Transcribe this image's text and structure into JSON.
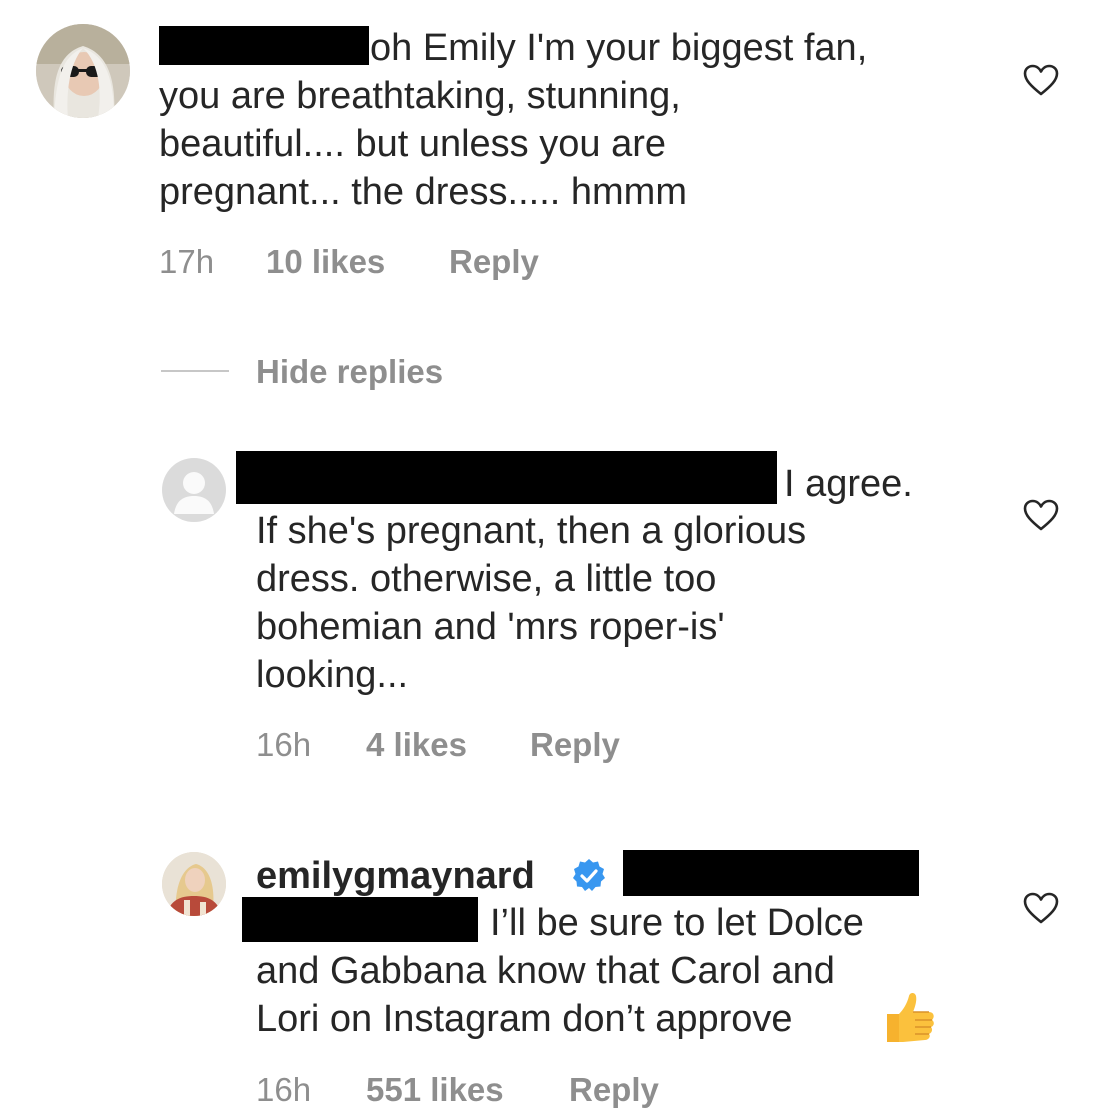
{
  "comments": [
    {
      "lines": [
        "oh Emily I'm your biggest fan,",
        "you are breathtaking,  stunning,",
        "beautiful.... but unless you are",
        "pregnant... the dress..... hmmm"
      ],
      "time": "17h",
      "likes": "10 likes",
      "reply": "Reply"
    }
  ],
  "hide_replies": "Hide replies",
  "replies": [
    {
      "lines": [
        "I agree.",
        "If she's pregnant, then a glorious",
        "dress.  otherwise, a little too",
        "bohemian and 'mrs roper-is'",
        "looking..."
      ],
      "time": "16h",
      "likes": "4 likes",
      "reply": "Reply"
    },
    {
      "username": "emilygmaynard",
      "verified_color": "#3897f0",
      "lines": [
        "I’ll be sure to let Dolce",
        "and Gabbana know that Carol and",
        "Lori on Instagram don’t approve"
      ],
      "emoji": "👍",
      "time": "16h",
      "likes": "551 likes",
      "reply": "Reply"
    }
  ],
  "icons": {
    "heart": "heart-icon",
    "verified": "verified-badge-icon",
    "thumbs": "thumbs-up-emoji"
  }
}
